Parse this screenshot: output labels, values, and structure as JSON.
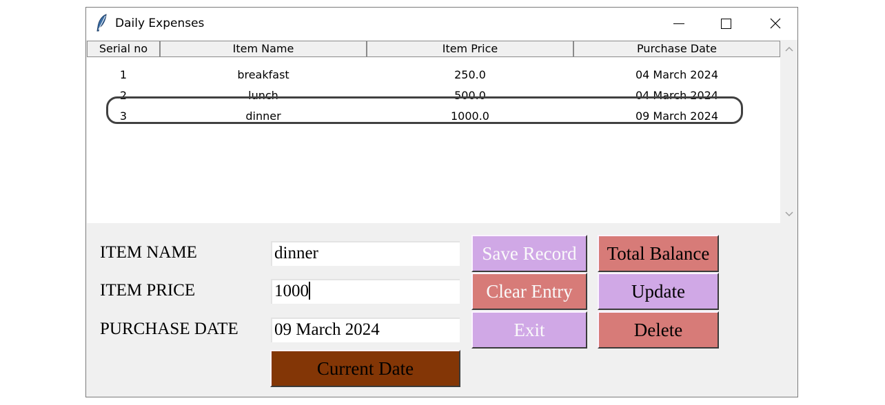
{
  "window": {
    "title": "Daily Expenses",
    "icon": "feather-icon",
    "controls": [
      "minimize-icon",
      "maximize-icon",
      "close-icon"
    ]
  },
  "table": {
    "columns": [
      "Serial no",
      "Item Name",
      "Item Price",
      "Purchase Date"
    ],
    "rows": [
      [
        "1",
        "breakfast",
        "250.0",
        "04 March 2024"
      ],
      [
        "2",
        "lunch",
        "500.0",
        "04 March 2024"
      ],
      [
        "3",
        "dinner",
        "1000.0",
        "09 March 2024"
      ]
    ]
  },
  "form": {
    "item_name_label": "ITEM NAME",
    "item_price_label": "ITEM PRICE",
    "purchase_date_label": "PURCHASE DATE",
    "item_name_value": "dinner",
    "item_price_value": "1000",
    "purchase_date_value": "09 March 2024"
  },
  "buttons": {
    "current_date": "Current Date",
    "save_record": "Save Record",
    "clear_entry": "Clear Entry",
    "exit": "Exit",
    "total_balance": "Total Balance",
    "update": "Update",
    "delete": "Delete"
  },
  "colors": {
    "lavender": "#d0a8e6",
    "salmon": "#d77b78",
    "brown": "#833606",
    "highlight_border": "#404040"
  }
}
